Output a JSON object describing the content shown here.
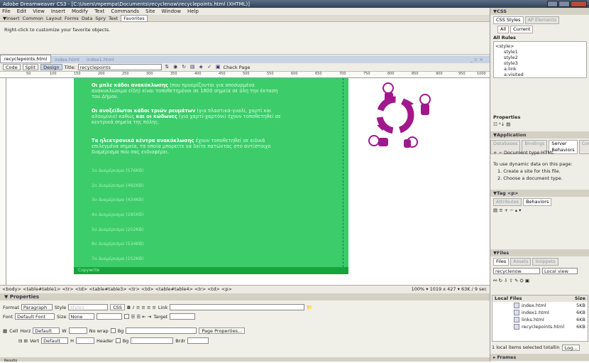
{
  "window": {
    "title": "Adobe Dreamweaver CS3 - [C:\\Users\\mpempa\\Documents\\recyclenow\\recyclepoints.html (XHTML)]"
  },
  "menu": [
    "File",
    "Edit",
    "View",
    "Insert",
    "Modify",
    "Text",
    "Commands",
    "Site",
    "Window",
    "Help"
  ],
  "insert_bar": {
    "label": "▼Insert",
    "tabs": [
      "Common",
      "Layout",
      "Forms",
      "Data",
      "Spry",
      "Text",
      "Favorites"
    ],
    "active": "Favorites",
    "hint": "Right-click to customize your favorite objects."
  },
  "doc_tabs": [
    "recyclepoints.html",
    "index.html",
    "index1.html"
  ],
  "doc_window_controls": "_ ▫ ×",
  "doc_toolbar": {
    "code": "Code",
    "split": "Split",
    "design": "Design",
    "title_label": "Title:",
    "title_value": "recyclepoints",
    "check_page": "Check Page"
  },
  "ruler": [
    "50",
    "100",
    "150",
    "200",
    "250",
    "300",
    "350",
    "400",
    "450",
    "500",
    "550",
    "600",
    "650",
    "700",
    "750",
    "800",
    "850",
    "900",
    "950",
    "1000"
  ],
  "content": {
    "p1_bold": "Οι μπλε κάδοι ανακύκλωσης",
    "p1_rest": " (που προορίζονται για αποσυρμένα ανακυκλώσιμα είδη) είναι τοποθετημένοι σε 1800 σημεία σε όλη την έκταση του Δήμου.",
    "p2_bold": "Οι ανοξείδωτοι κάδοι τριών ρευμάτων",
    "p2_mid": " (για πλαστικά-γυαλί, χαρτί και αλουμίνιο) καθώς ",
    "p2_bold2": "και οι κώδωνες",
    "p2_rest": " (για χαρτί-χαρτόνι) έχουν τοποθετηθεί σε κεντρικά σημεία της πόλης.",
    "p3_bold": "Τα ηλεκτρονικά κέντρα ανακύκλωσης",
    "p3_rest": " έχουν τοποθετηθεί σε ειδικά επιλεγμένα σημεία, τα οποία μπορείτε να δείτε πατώντας στο αντίστοιχο διαμέρισμα που σας ενδιαφέρει.",
    "links": [
      "1ο Διαμέρισμα (576KB)",
      "2ο Διαμέρισμα (492KB)",
      "3ο Διαμέρισμα (434KB)",
      "4ο Διαμέρισμα (285KB)",
      "5ο Διαμέρισμα (202KB)",
      "6ο Διαμέρισμα (534KB)",
      "7ο Διαμέρισμα (152KB)"
    ],
    "footer": "Copywrite"
  },
  "status": {
    "tags": "<body> <table#table1> <tr> <td> <table#table3> <tr> <td> <table#table4> <tr> <td> <p>",
    "zoom": "100%",
    "size": "1019 x 427",
    "weight": "63K / 9 sec"
  },
  "properties": {
    "header": "Properties",
    "format_label": "Format",
    "format_value": "Paragraph",
    "style_label": "Style",
    "style_value": "style1",
    "css_button": "CSS",
    "link_label": "Link",
    "font_label": "Font",
    "font_value": "Default Font",
    "size_label": "Size",
    "size_value": "None",
    "target_label": "Target",
    "cell_label": "Cell",
    "horz_label": "Horz",
    "horz_value": "Default",
    "w_label": "W",
    "nowrap_label": "No wrap",
    "bg_label": "Bg",
    "page_props": "Page Properties...",
    "vert_label": "Vert",
    "vert_value": "Default",
    "h_label": "H",
    "header_label": "Header",
    "bg2_label": "Bg",
    "brdr_label": "Brdr"
  },
  "results_label": "Results",
  "panels": {
    "css_header": "▼CSS",
    "css_tabs": [
      "CSS Styles",
      "AP Elements"
    ],
    "css_modes": [
      "All",
      "Current"
    ],
    "rules_label": "All Rules",
    "rules": [
      "<style>",
      "style1",
      "style2",
      "style3",
      "a:link",
      "a:visited",
      "a:hover"
    ],
    "properties_label": "Properties",
    "application_header": "▼Application",
    "app_tabs": [
      "Databases",
      "Bindings",
      "Server Behaviors",
      "Com"
    ],
    "doc_type": "Document type:HTML",
    "dynamic_intro": "To use dynamic data on this page:",
    "step1": "1. Create a site for this file.",
    "step2": "2. Choose a document type.",
    "tag_header": "▼Tag <p>",
    "tag_tabs": [
      "Attributes",
      "Behaviors"
    ],
    "files_header": "▼Files",
    "files_tabs": [
      "Files",
      "Assets",
      "Snippets"
    ],
    "site": "recyclenow",
    "view": "Local view",
    "local_files_label": "Local Files",
    "size_label": "Size",
    "files": [
      {
        "name": "index.html",
        "size": "5KB"
      },
      {
        "name": "index1.html",
        "size": "6KB"
      },
      {
        "name": "links.html",
        "size": "6KB"
      },
      {
        "name": "recyclepoints.html",
        "size": "6KB"
      }
    ],
    "files_status": "1 local items selected totallin",
    "log_button": "Log...",
    "frames_label": "Frames"
  }
}
